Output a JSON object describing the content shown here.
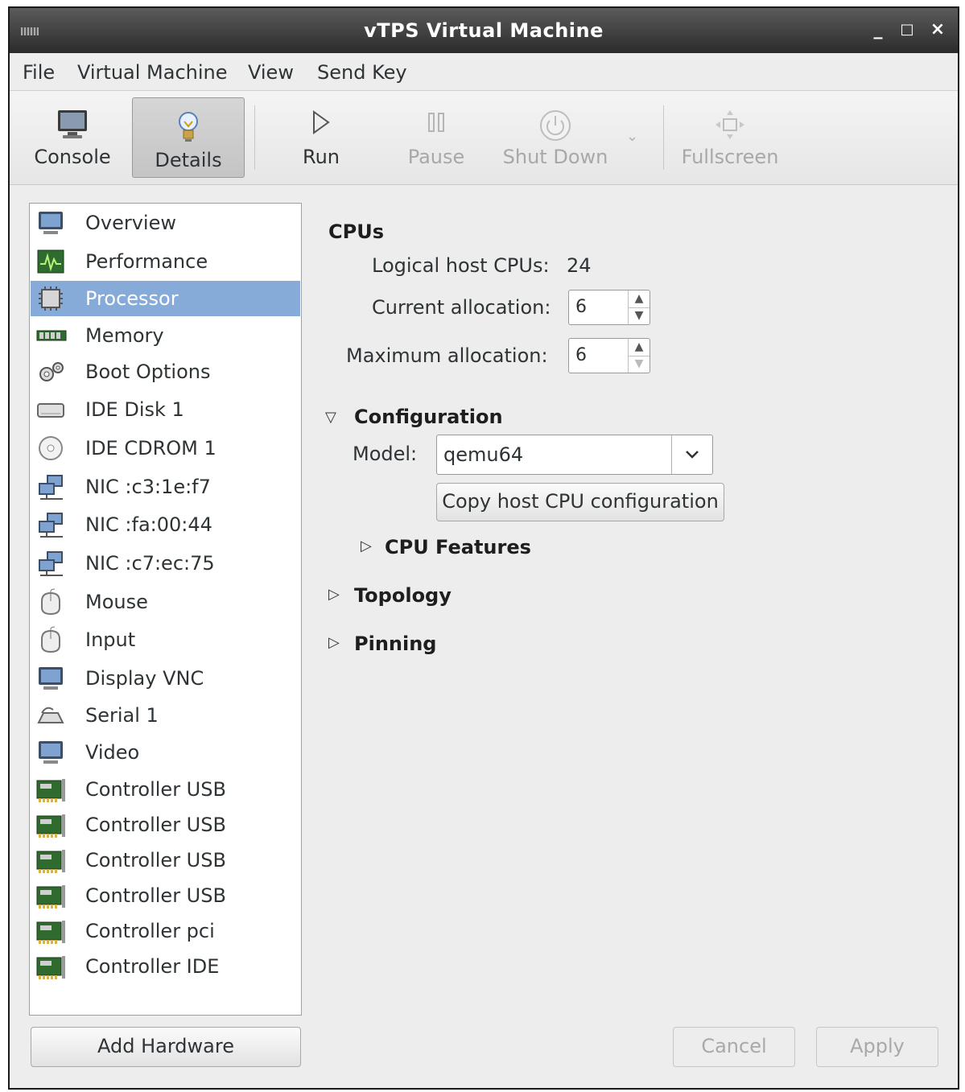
{
  "window": {
    "title": "vTPS Virtual Machine"
  },
  "menubar": {
    "file": "File",
    "virtual_machine": "Virtual Machine",
    "view": "View",
    "send_key": "Send Key"
  },
  "toolbar": {
    "console": "Console",
    "details": "Details",
    "run": "Run",
    "pause": "Pause",
    "shut_down": "Shut Down",
    "fullscreen": "Fullscreen"
  },
  "sidebar": {
    "items": [
      {
        "label": "Overview",
        "icon": "monitor-icon"
      },
      {
        "label": "Performance",
        "icon": "performance-icon"
      },
      {
        "label": "Processor",
        "icon": "cpu-chip-icon",
        "selected": true
      },
      {
        "label": "Memory",
        "icon": "memory-icon"
      },
      {
        "label": "Boot Options",
        "icon": "gears-icon"
      },
      {
        "label": "IDE Disk 1",
        "icon": "hard-disk-icon"
      },
      {
        "label": "IDE CDROM 1",
        "icon": "cdrom-icon"
      },
      {
        "label": "NIC :c3:1e:f7",
        "icon": "network-icon"
      },
      {
        "label": "NIC :fa:00:44",
        "icon": "network-icon"
      },
      {
        "label": "NIC :c7:ec:75",
        "icon": "network-icon"
      },
      {
        "label": "Mouse",
        "icon": "mouse-icon"
      },
      {
        "label": "Input",
        "icon": "mouse-icon"
      },
      {
        "label": "Display VNC",
        "icon": "monitor-icon"
      },
      {
        "label": "Serial 1",
        "icon": "serial-icon"
      },
      {
        "label": "Video",
        "icon": "monitor-icon"
      },
      {
        "label": "Controller USB",
        "icon": "controller-card-icon"
      },
      {
        "label": "Controller USB",
        "icon": "controller-card-icon"
      },
      {
        "label": "Controller USB",
        "icon": "controller-card-icon"
      },
      {
        "label": "Controller USB",
        "icon": "controller-card-icon"
      },
      {
        "label": "Controller pci",
        "icon": "controller-card-icon"
      },
      {
        "label": "Controller IDE",
        "icon": "controller-card-icon"
      }
    ],
    "add_hardware": "Add Hardware"
  },
  "cpus": {
    "heading": "CPUs",
    "logical_label": "Logical host CPUs:",
    "logical_value": "24",
    "current_label": "Current allocation:",
    "current_value": "6",
    "maximum_label": "Maximum allocation:",
    "maximum_value": "6"
  },
  "configuration": {
    "heading": "Configuration",
    "model_label": "Model:",
    "model_value": "qemu64",
    "copy_button": "Copy host CPU configuration",
    "cpu_features": "CPU Features"
  },
  "topology": "Topology",
  "pinning": "Pinning",
  "footer": {
    "cancel": "Cancel",
    "apply": "Apply"
  },
  "colors": {
    "selection": "#86abd9",
    "titlebar": "#2b2b2b"
  }
}
